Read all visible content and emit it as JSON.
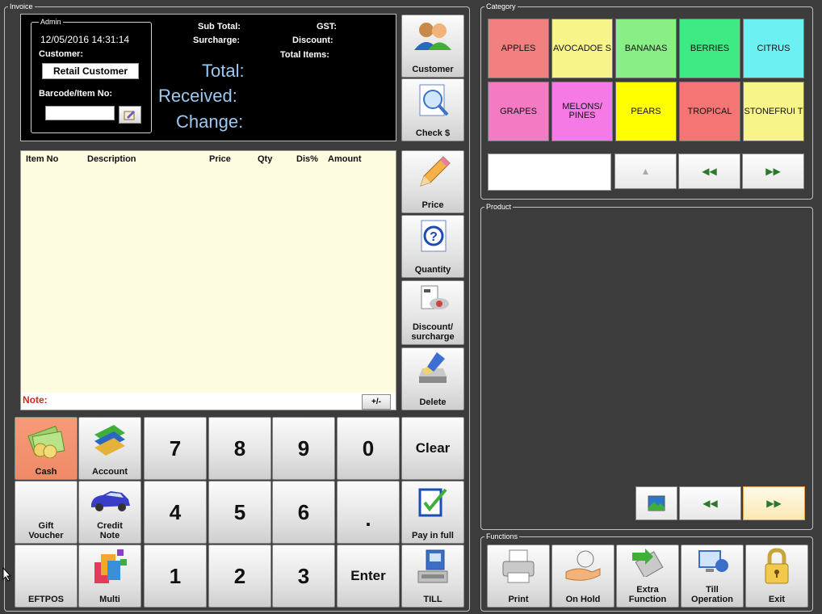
{
  "groups": {
    "invoice": "Invoice",
    "category": "Category",
    "product": "Product",
    "functions": "Functions",
    "admin": "Admin"
  },
  "info": {
    "datetime": "12/05/2016 14:31:14",
    "customer_label": "Customer:",
    "customer_value": "Retail Customer",
    "barcode_label": "Barcode/Item No:",
    "subtotal_label": "Sub Total:",
    "surcharge_label": "Surcharge:",
    "gst_label": "GST:",
    "discount_label": "Discount:",
    "total_items_label": "Total Items:",
    "total_label": "Total:",
    "received_label": "Received:",
    "change_label": "Change:"
  },
  "side": {
    "customer": "Customer",
    "check": "Check $",
    "price": "Price",
    "quantity": "Quantity",
    "discount1": "Discount/",
    "discount2": "surcharge",
    "delete": "Delete"
  },
  "table": {
    "cols": [
      "Item No",
      "Description",
      "Price",
      "Qty",
      "Dis%",
      "Amount"
    ],
    "note": "Note:",
    "plusminus": "+/-"
  },
  "keypad": {
    "cash": "Cash",
    "account": "Account",
    "gift1": "Gift",
    "gift2": "Voucher",
    "credit1": "Credit",
    "credit2": "Note",
    "eftpos": "EFTPOS",
    "multi": "Multi",
    "clear": "Clear",
    "payfull": "Pay in full",
    "enter": "Enter",
    "till": "TILL",
    "d7": "7",
    "d8": "8",
    "d9": "9",
    "d0": "0",
    "d4": "4",
    "d5": "5",
    "d6": "6",
    "dot": ".",
    "d1": "1",
    "d2": "2",
    "d3": "3"
  },
  "categories": [
    {
      "label": "APPLES",
      "color": "#f28080"
    },
    {
      "label": "AVOCADOE S",
      "color": "#f7f48a"
    },
    {
      "label": "BANANAS",
      "color": "#88ef86"
    },
    {
      "label": "BERRIES",
      "color": "#3eea84"
    },
    {
      "label": "CITRUS",
      "color": "#6cf0f2"
    },
    {
      "label": "GRAPES",
      "color": "#f57ac4"
    },
    {
      "label": "MELONS/ PINES",
      "color": "#f57ae6"
    },
    {
      "label": "PEARS",
      "color": "#ffff00"
    },
    {
      "label": "TROPICAL",
      "color": "#f57474"
    },
    {
      "label": "STONEFRUI T",
      "color": "#f7f48a"
    }
  ],
  "functions": {
    "print": "Print",
    "onhold": "On Hold",
    "extra1": "Extra",
    "extra2": "Function",
    "till1": "Till",
    "till2": "Operation",
    "exit": "Exit"
  },
  "icons": [
    "customer-icon",
    "check-icon",
    "pencil-icon",
    "help-icon",
    "discount-icon",
    "delete-icon",
    "cash-icon",
    "account-icon",
    "car-icon",
    "multi-icon",
    "payfull-icon",
    "till-icon",
    "print-icon",
    "onhold-icon",
    "extra-function-icon",
    "till-operation-icon",
    "lock-icon",
    "picture-icon",
    "left-arrow-icon",
    "right-arrow-icon",
    "up-arrow-icon"
  ]
}
